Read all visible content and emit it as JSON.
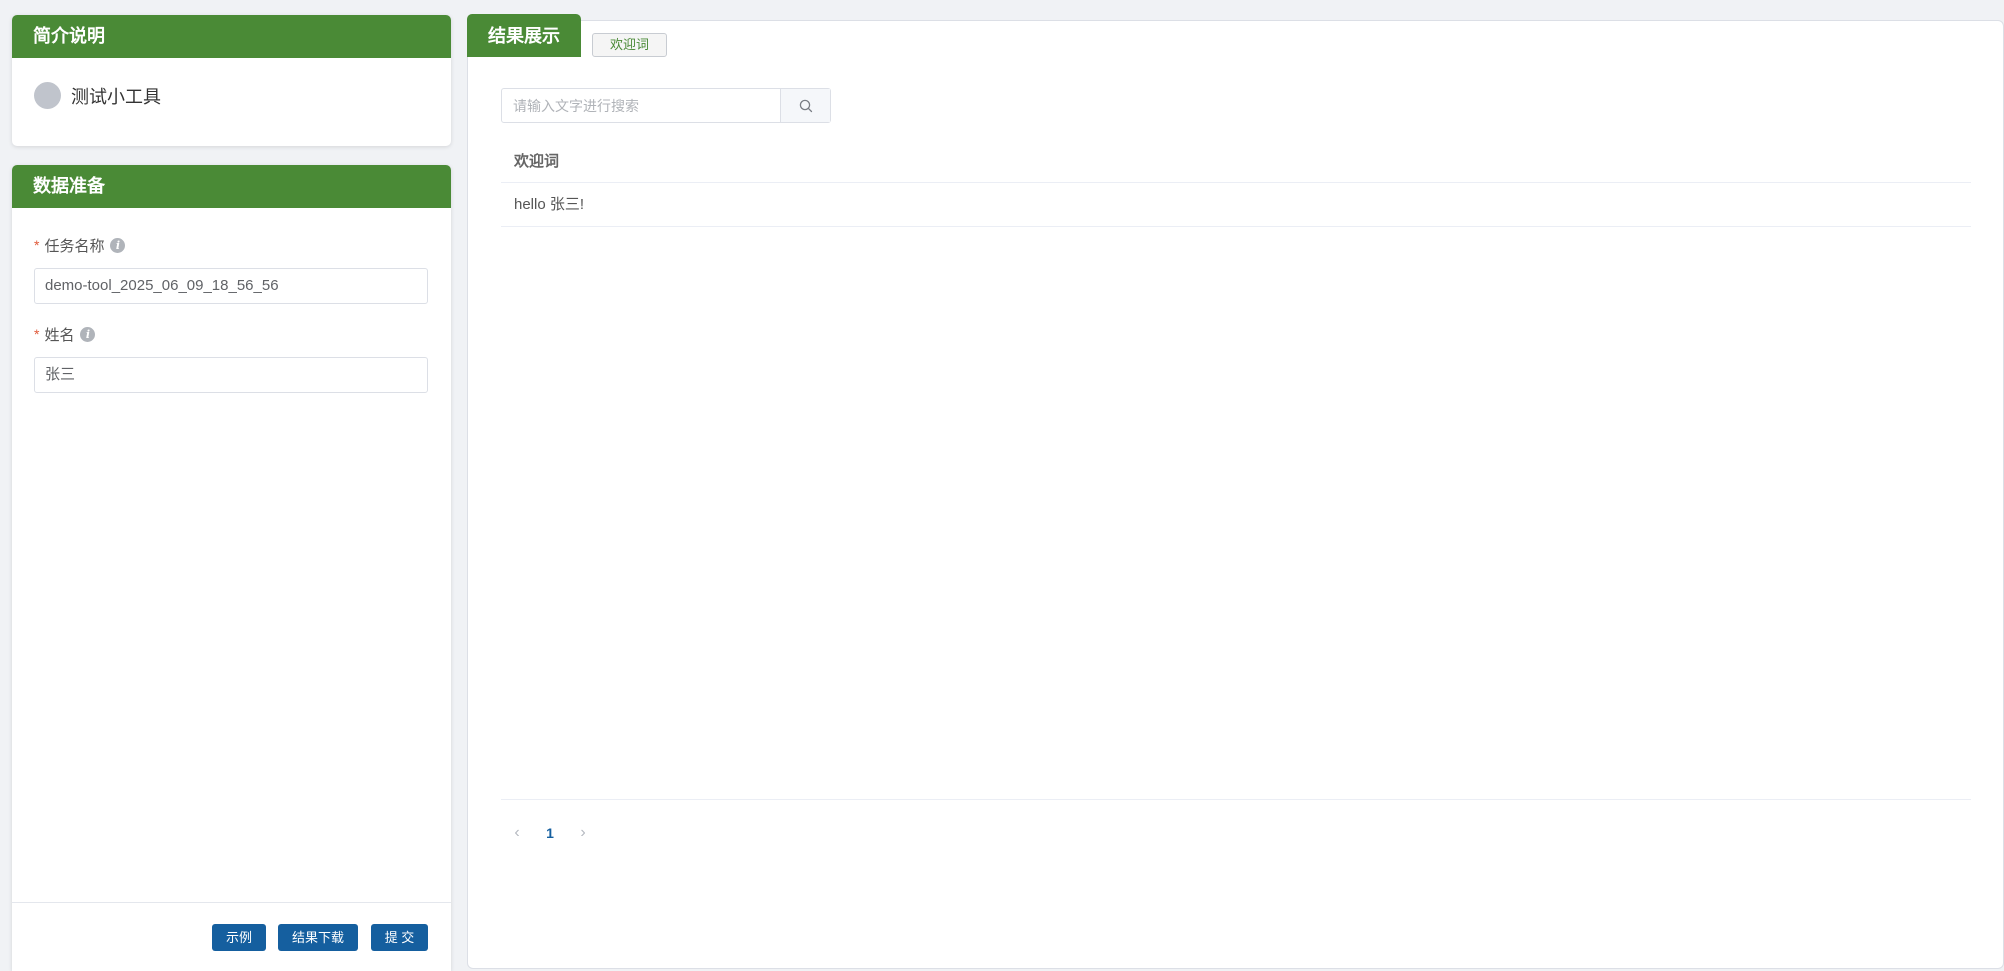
{
  "intro": {
    "header": "简介说明",
    "tool_name": "测试小工具"
  },
  "data_prep": {
    "header": "数据准备",
    "fields": [
      {
        "label": "任务名称",
        "value": "demo-tool_2025_06_09_18_56_56"
      },
      {
        "label": "姓名",
        "value": "张三"
      }
    ],
    "required_mark": "*",
    "info_glyph": "i"
  },
  "footer": {
    "example_label": "示例",
    "download_label": "结果下载",
    "submit_label": "提 交"
  },
  "result": {
    "tab_label": "结果展示",
    "sub_tab_label": "欢迎词",
    "search_placeholder": "请输入文字进行搜索",
    "table": {
      "columns": [
        "欢迎词"
      ],
      "rows": [
        [
          "hello 张三!"
        ]
      ]
    },
    "pagination": {
      "current_page": "1",
      "prev_glyph": "‹",
      "next_glyph": "›"
    }
  },
  "colors": {
    "header_green": "#4a8a36",
    "button_blue": "#155f9f",
    "background": "#f0f2f5"
  }
}
